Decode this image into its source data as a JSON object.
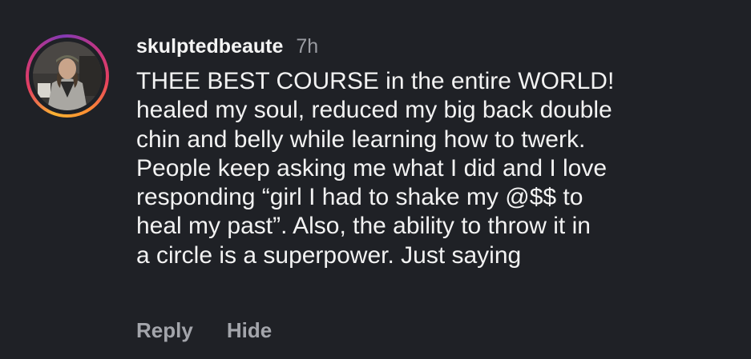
{
  "comment": {
    "username": "skulptedbeaute",
    "time": "7h",
    "text": "THEE BEST COURSE in the entire WORLD!\nhealed my soul, reduced my big back double\nchin and belly while learning how to twerk.\nPeople keep asking me what I did and I love\nresponding “girl I had to shake my @$$ to\nheal my past”. Also, the ability to throw it in\na circle is a superpower. Just saying",
    "actions": {
      "reply_label": "Reply",
      "hide_label": "Hide"
    }
  },
  "colors": {
    "background": "#1f2126",
    "text": "#f2f2f2",
    "muted": "#9a9ca2",
    "story_ring": [
      "#f9b233",
      "#e4405f",
      "#c13584",
      "#833ab4"
    ]
  },
  "icons": {
    "avatar": "profile-photo"
  }
}
